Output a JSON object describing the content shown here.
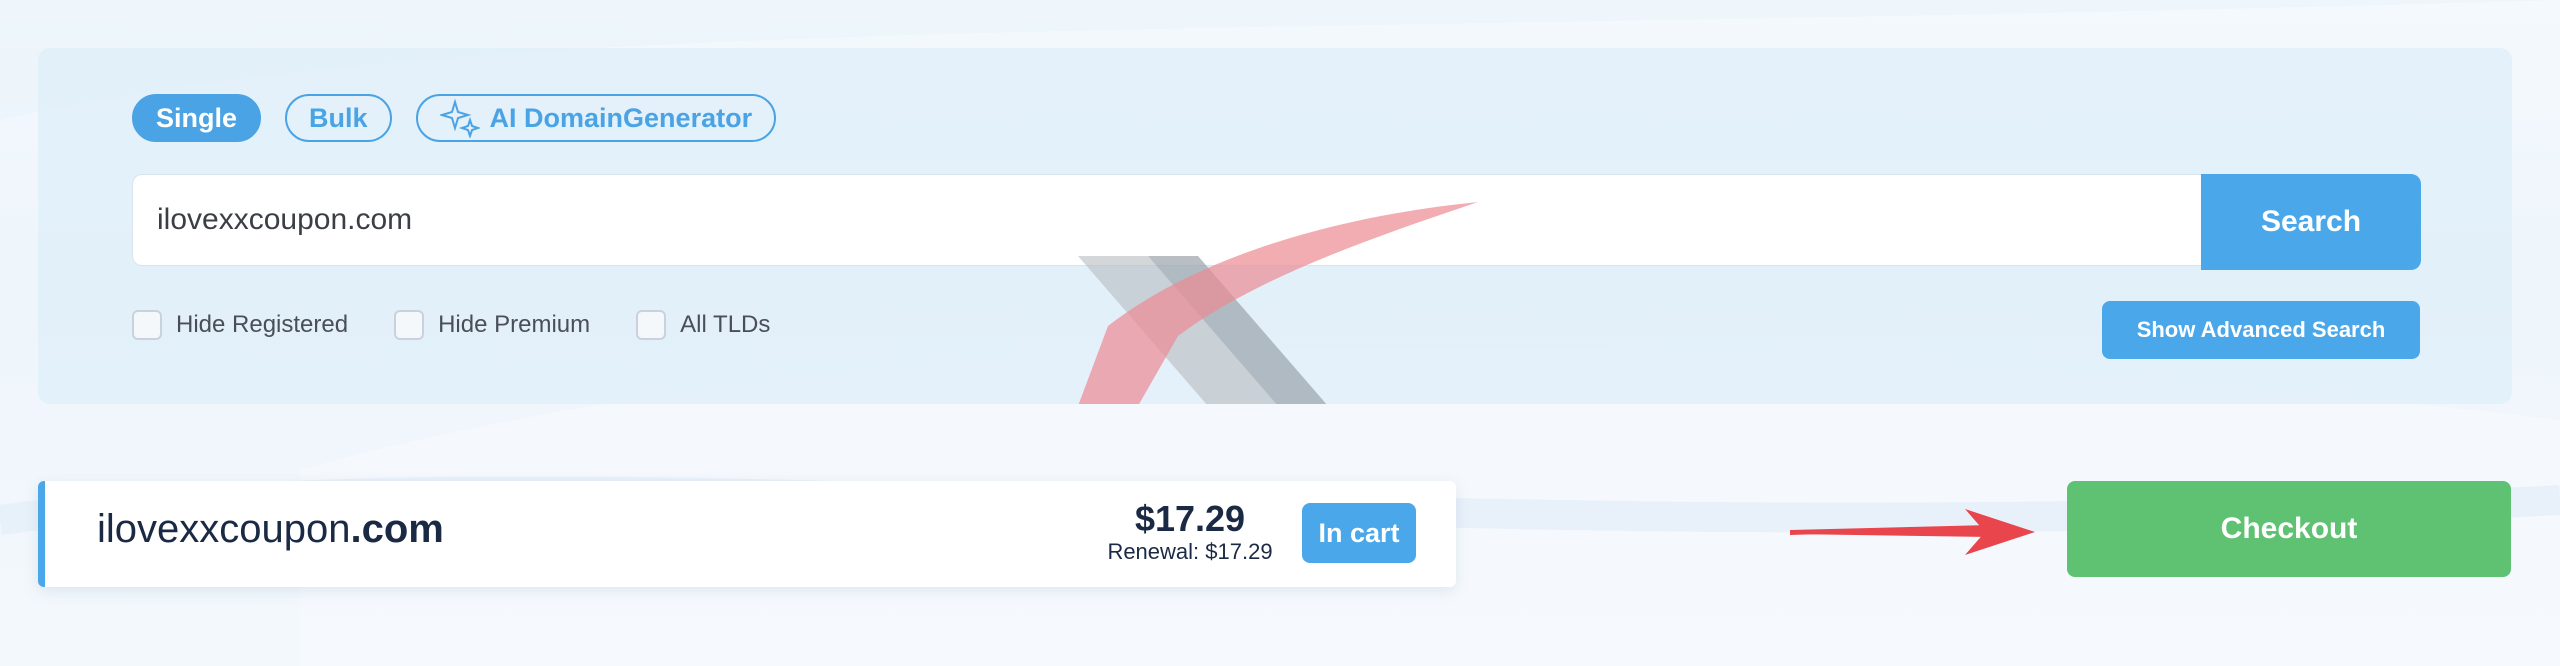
{
  "search": {
    "tabs": [
      {
        "label": "Single",
        "active": true
      },
      {
        "label": "Bulk",
        "active": false
      },
      {
        "label": "AI DomainGenerator",
        "active": false,
        "icon": "sparkle-icon"
      }
    ],
    "query_value": "ilovexxcoupon.com",
    "search_label": "Search",
    "filters": [
      {
        "label": "Hide Registered",
        "checked": false
      },
      {
        "label": "Hide Premium",
        "checked": false
      },
      {
        "label": "All TLDs",
        "checked": false
      }
    ],
    "advanced_label": "Show Advanced Search"
  },
  "result": {
    "domain_name": "ilovexxcoupon",
    "domain_tld": ".com",
    "price": "$17.29",
    "renewal": "Renewal: $17.29",
    "cart_label": "In cart"
  },
  "checkout": {
    "label": "Checkout"
  },
  "colors": {
    "accent": "#4aa8ea",
    "checkout": "#5ec272",
    "annotation_arrow": "#e8454c"
  }
}
